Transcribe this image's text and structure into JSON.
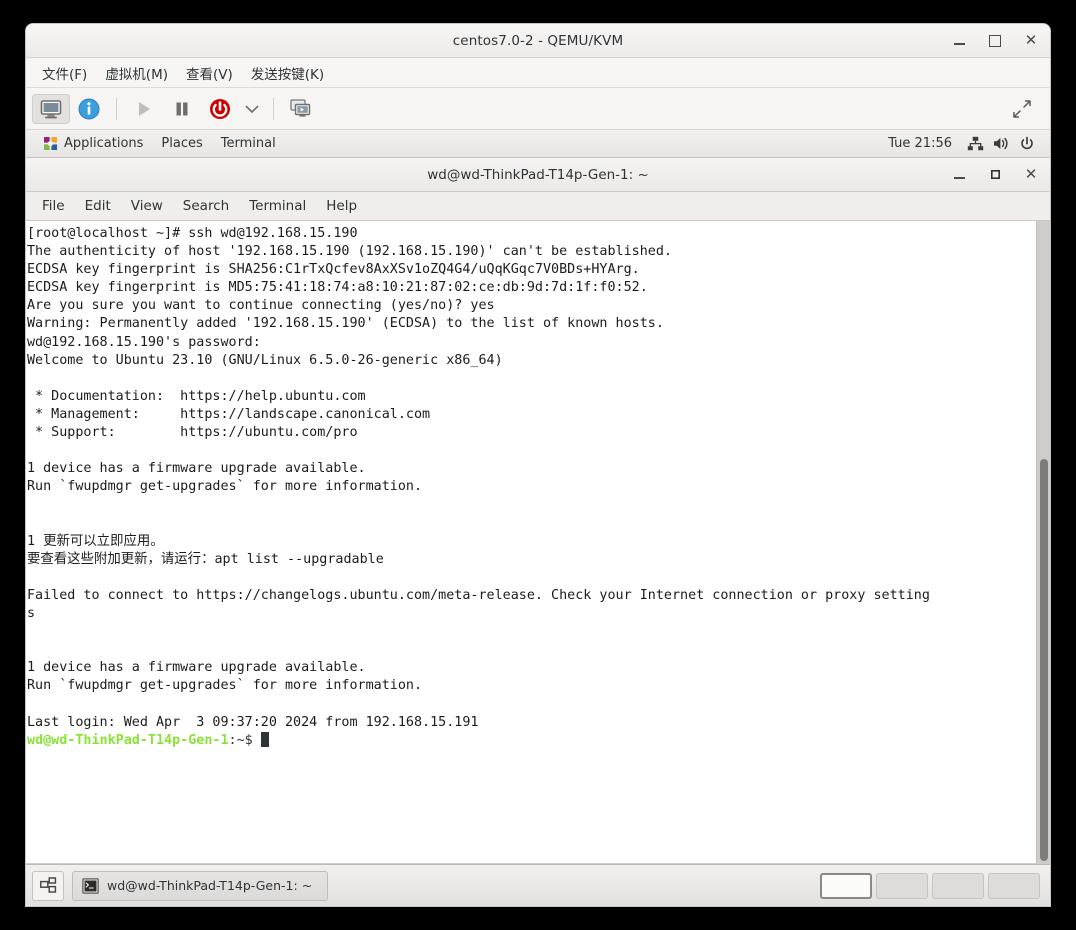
{
  "vm_window": {
    "title": "centos7.0-2 - QEMU/KVM",
    "menus": [
      {
        "label": "文件(F)",
        "name": "menu-file"
      },
      {
        "label": "虚拟机(M)",
        "name": "menu-virtual-machine"
      },
      {
        "label": "查看(V)",
        "name": "menu-view"
      },
      {
        "label": "发送按键(K)",
        "name": "menu-send-key"
      }
    ],
    "window_controls": {
      "minimize": "–",
      "maximize": "☐",
      "close": "✕"
    },
    "toolbar": [
      {
        "name": "console-view-button",
        "icon": "monitor-icon",
        "active": true
      },
      {
        "name": "vm-details-button",
        "icon": "info-icon",
        "active": false
      },
      {
        "name": "run-button",
        "icon": "play-icon",
        "active": false,
        "disabled": true
      },
      {
        "name": "pause-button",
        "icon": "pause-icon",
        "active": false
      },
      {
        "name": "shutdown-button",
        "icon": "power-icon",
        "active": false
      },
      {
        "name": "shutdown-menu-button",
        "icon": "chevron-down-icon",
        "active": false
      },
      {
        "name": "snapshots-button",
        "icon": "snapshot-icon",
        "active": false
      }
    ],
    "fullscreen_icon": "fullscreen-arrows-icon"
  },
  "gnome_panel": {
    "applications": "Applications",
    "places": "Places",
    "terminal": "Terminal",
    "clock": "Tue 21:56",
    "tray": [
      {
        "name": "network-icon",
        "icon": "network-wired-icon"
      },
      {
        "name": "volume-icon",
        "icon": "speaker-icon"
      },
      {
        "name": "system-power-icon",
        "icon": "power-icon"
      }
    ]
  },
  "terminal_window": {
    "title": "wd@wd-ThinkPad-T14p-Gen-1: ~",
    "menus": [
      {
        "label": "File",
        "name": "terminal-menu-file"
      },
      {
        "label": "Edit",
        "name": "terminal-menu-edit"
      },
      {
        "label": "View",
        "name": "terminal-menu-view"
      },
      {
        "label": "Search",
        "name": "terminal-menu-search"
      },
      {
        "label": "Terminal",
        "name": "terminal-menu-terminal"
      },
      {
        "label": "Help",
        "name": "terminal-menu-help"
      }
    ],
    "window_controls": {
      "minimize": "–",
      "maximize": "□",
      "close": "✕"
    },
    "lines": [
      "[root@localhost ~]# ssh wd@192.168.15.190",
      "The authenticity of host '192.168.15.190 (192.168.15.190)' can't be established.",
      "ECDSA key fingerprint is SHA256:C1rTxQcfev8AxXSv1oZQ4G4/uQqKGqc7V0BDs+HYArg.",
      "ECDSA key fingerprint is MD5:75:41:18:74:a8:10:21:87:02:ce:db:9d:7d:1f:f0:52.",
      "Are you sure you want to continue connecting (yes/no)? yes",
      "Warning: Permanently added '192.168.15.190' (ECDSA) to the list of known hosts.",
      "wd@192.168.15.190's password:",
      "Welcome to Ubuntu 23.10 (GNU/Linux 6.5.0-26-generic x86_64)",
      "",
      " * Documentation:  https://help.ubuntu.com",
      " * Management:     https://landscape.canonical.com",
      " * Support:        https://ubuntu.com/pro",
      "",
      "1 device has a firmware upgrade available.",
      "Run `fwupdmgr get-upgrades` for more information.",
      "",
      "",
      "1 更新可以立即应用。",
      "要查看这些附加更新，请运行：apt list --upgradable",
      "",
      "Failed to connect to https://changelogs.ubuntu.com/meta-release. Check your Internet connection or proxy setting",
      "s",
      "",
      "",
      "1 device has a firmware upgrade available.",
      "Run `fwupdmgr get-upgrades` for more information.",
      "",
      "Last login: Wed Apr  3 09:37:20 2024 from 192.168.15.191"
    ],
    "prompt": {
      "user_host": "wd@wd-ThinkPad-T14p-Gen-1",
      "path": ":~$ "
    },
    "colors": {
      "prompt_green": "#8ae234",
      "text": "#1c1c1c",
      "background": "#ffffff"
    }
  },
  "taskbar": {
    "show_desktop_icon": "show-desktop-icon",
    "task_button": {
      "label": "wd@wd-ThinkPad-T14p-Gen-1: ~",
      "icon": "terminal-icon"
    },
    "workspaces": [
      {
        "name": "workspace-1",
        "active": true
      },
      {
        "name": "workspace-2",
        "active": false
      },
      {
        "name": "workspace-3",
        "active": false
      },
      {
        "name": "workspace-4",
        "active": false
      }
    ]
  }
}
